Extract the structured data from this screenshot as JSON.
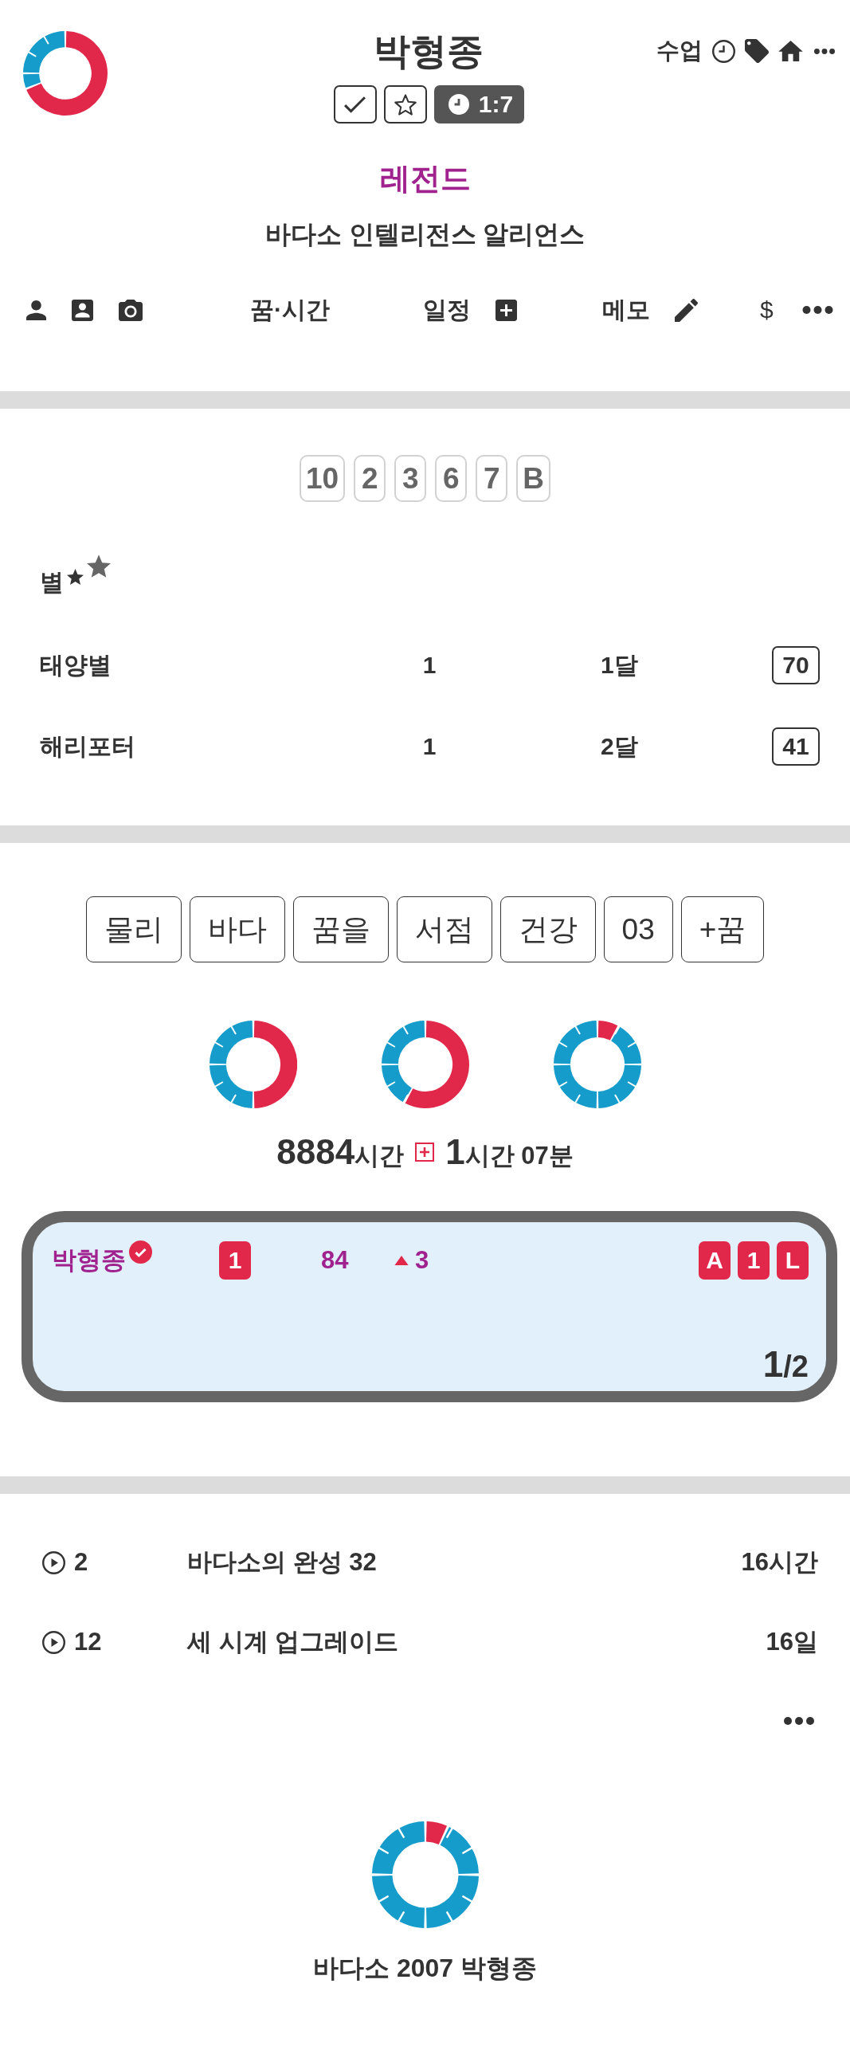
{
  "header": {
    "title": "박형종",
    "action_label": "수업",
    "timer": "1:7",
    "rank": "레전드",
    "alliance": "바다소 인텔리전스 알리언스"
  },
  "toolbar": {
    "tabs": [
      "꿈·시간",
      "일정",
      "메모"
    ],
    "currency": "$"
  },
  "number_chips": [
    "10",
    "2",
    "3",
    "6",
    "7",
    "B"
  ],
  "stars": {
    "heading": "별",
    "rows": [
      {
        "name": "태양별",
        "count": "1",
        "period": "1달",
        "score": "70"
      },
      {
        "name": "해리포터",
        "count": "1",
        "period": "2달",
        "score": "41"
      }
    ]
  },
  "tags": [
    "물리",
    "바다",
    "꿈을",
    "서점",
    "건강",
    "03",
    "+꿈"
  ],
  "total_time": {
    "hours": "8884",
    "hours_unit": "시간",
    "added_hours": "1",
    "added_rest": "시간 07분"
  },
  "member_card": {
    "name": "박형종",
    "verified": true,
    "rank": "1",
    "score": "84",
    "rising": true,
    "change": "3",
    "grades": [
      "A",
      "1",
      "L"
    ],
    "page": "1",
    "page_total": "/2"
  },
  "sessions": [
    {
      "number": "2",
      "title": "바다소의 완성 32",
      "duration": "16시간"
    },
    {
      "number": "12",
      "title": "세 시계 업그레이드",
      "duration": "16일"
    }
  ],
  "footer": {
    "caption": "바다소 2007 박형종"
  }
}
